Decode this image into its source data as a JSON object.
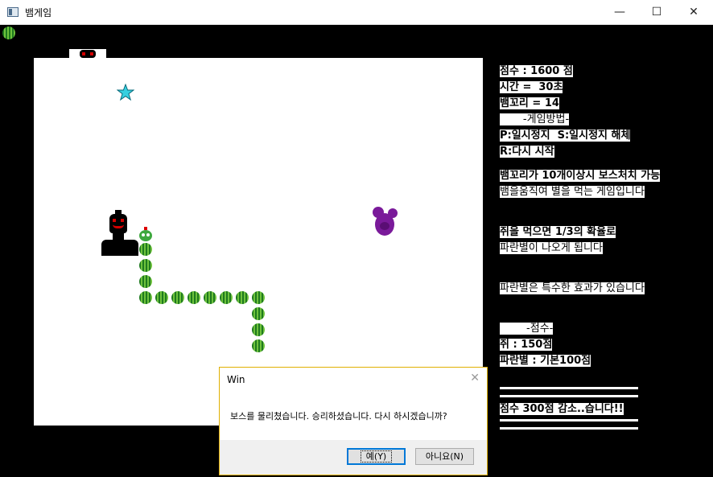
{
  "window": {
    "title": "뱀게임",
    "minimize_glyph": "—",
    "maximize_glyph": "☐",
    "close_glyph": "✕"
  },
  "info_panel": {
    "lines": [
      {
        "text": "점수 : 1600 점",
        "bold": true
      },
      {
        "text": "시간 =  30초",
        "bold": true
      },
      {
        "text": "뱀꼬리 = 14",
        "bold": true
      },
      {
        "text": "       -게임방법-",
        "bold": false
      },
      {
        "text": "P:일시정지  S:일시정지 해체",
        "bold": true
      },
      {
        "text": "R:다시 시작",
        "bold": true
      },
      {
        "text": "뱀꼬리가 10개이상시 보스처치 가능",
        "bold": true
      },
      {
        "text": "뱀을움직여 별을 먹는 게임입니다",
        "bold": false
      },
      {
        "text": "쥐을 먹으면 1/3의 확율로",
        "bold": true
      },
      {
        "text": "파란별이 나오게 됩니다",
        "bold": false
      },
      {
        "text": "파란별은 특수한 효과가 있습니다",
        "bold": false
      },
      {
        "text": "        -점수-",
        "bold": false
      },
      {
        "text": "쥐 : 150점",
        "bold": true
      },
      {
        "text": "파란별 : 기본100점",
        "bold": true
      },
      {
        "text": "점수 300점 감소..습니다!!",
        "bold": true
      }
    ]
  },
  "game": {
    "boss_color": "#d40000",
    "mouse_color": "#7a1a9a",
    "star_color": "#35d0e0",
    "snake_color": "#2e8b2e",
    "tail_count": 14
  },
  "dialog": {
    "title": "Win",
    "message": "보스를 물리쳤습니다. 승리하셨습니다. 다시 하시겠습니까?",
    "yes_label": "예(Y)",
    "no_label": "아니요(N)",
    "close_glyph": "✕"
  }
}
